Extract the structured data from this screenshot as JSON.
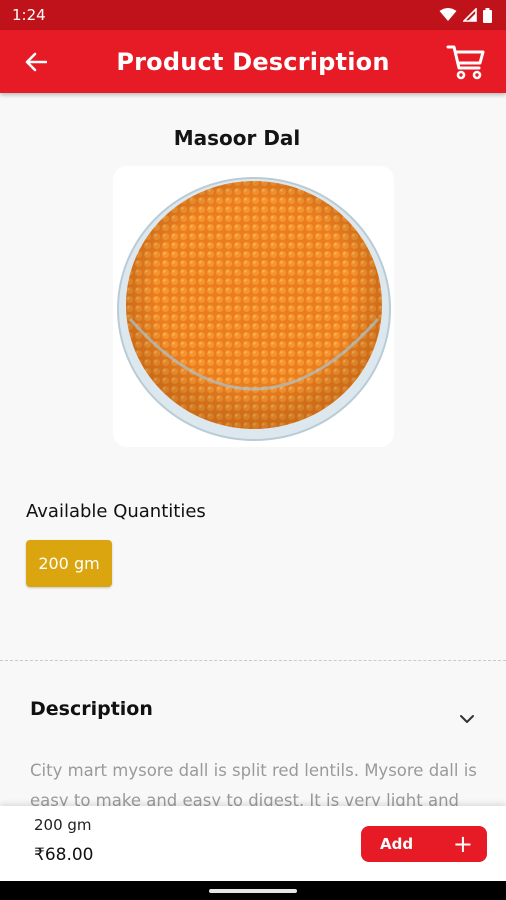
{
  "status_bar": {
    "time": "1:24",
    "icons": [
      "wifi-icon",
      "signal-icon",
      "battery-icon"
    ]
  },
  "app_bar": {
    "title": "Product Description",
    "back_icon": "arrow-left-icon",
    "cart_icon": "shopping-cart-icon"
  },
  "product": {
    "name": "Masoor Dal",
    "image": "bowl of masoor dal lentils"
  },
  "quantities": {
    "label": "Available Quantities",
    "options": [
      "200 gm"
    ],
    "selected": "200 gm"
  },
  "description": {
    "title": "Description",
    "toggle_icon": "chevron-down-icon",
    "text": "City mart mysore dall is split red lentils. Mysore dall is easy to make and easy to digest. It is very light and"
  },
  "bottom_bar": {
    "quantity": "200 gm",
    "price": "₹68.00",
    "add_label": "Add",
    "add_icon": "+"
  },
  "colors": {
    "primary": "#e61b25",
    "status_bar": "#c0121b",
    "quantity_chip": "#dba510",
    "lentil": "#f08a26"
  }
}
